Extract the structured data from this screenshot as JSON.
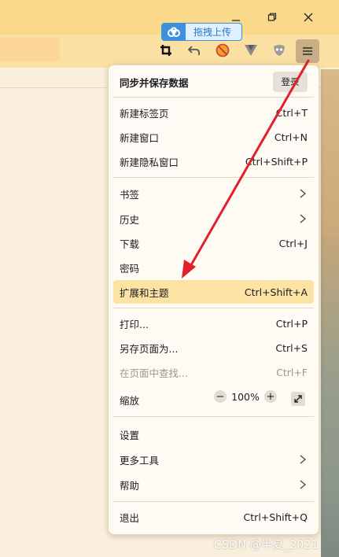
{
  "window": {
    "minimize_icon": "minimize-icon",
    "maximize_icon": "restore-icon",
    "close_icon": "close-icon"
  },
  "upload_extension": {
    "label": "拖拽上传"
  },
  "menu": {
    "sync_title": "同步并保存数据",
    "signin_label": "登录",
    "items": [
      {
        "label": "新建标签页",
        "shortcut": "Ctrl+T"
      },
      {
        "label": "新建窗口",
        "shortcut": "Ctrl+N"
      },
      {
        "label": "新建隐私窗口",
        "shortcut": "Ctrl+Shift+P"
      },
      {
        "label": "书签",
        "shortcut": ""
      },
      {
        "label": "历史",
        "shortcut": ""
      },
      {
        "label": "下载",
        "shortcut": "Ctrl+J"
      },
      {
        "label": "密码",
        "shortcut": ""
      },
      {
        "label": "扩展和主题",
        "shortcut": "Ctrl+Shift+A"
      },
      {
        "label": "打印...",
        "shortcut": "Ctrl+P"
      },
      {
        "label": "另存页面为...",
        "shortcut": "Ctrl+S"
      },
      {
        "label": "在页面中查找...",
        "shortcut": "Ctrl+F"
      },
      {
        "label": "缩放",
        "shortcut": ""
      },
      {
        "label": "设置",
        "shortcut": ""
      },
      {
        "label": "更多工具",
        "shortcut": ""
      },
      {
        "label": "帮助",
        "shortcut": ""
      },
      {
        "label": "退出",
        "shortcut": "Ctrl+Shift+Q"
      }
    ],
    "zoom": {
      "minus": "−",
      "value": "100%",
      "plus": "+"
    }
  },
  "watermark": "CSDN @半夏_2021",
  "colors": {
    "annotation_arrow": "#e0202a",
    "highlight": "#fce3a3"
  }
}
